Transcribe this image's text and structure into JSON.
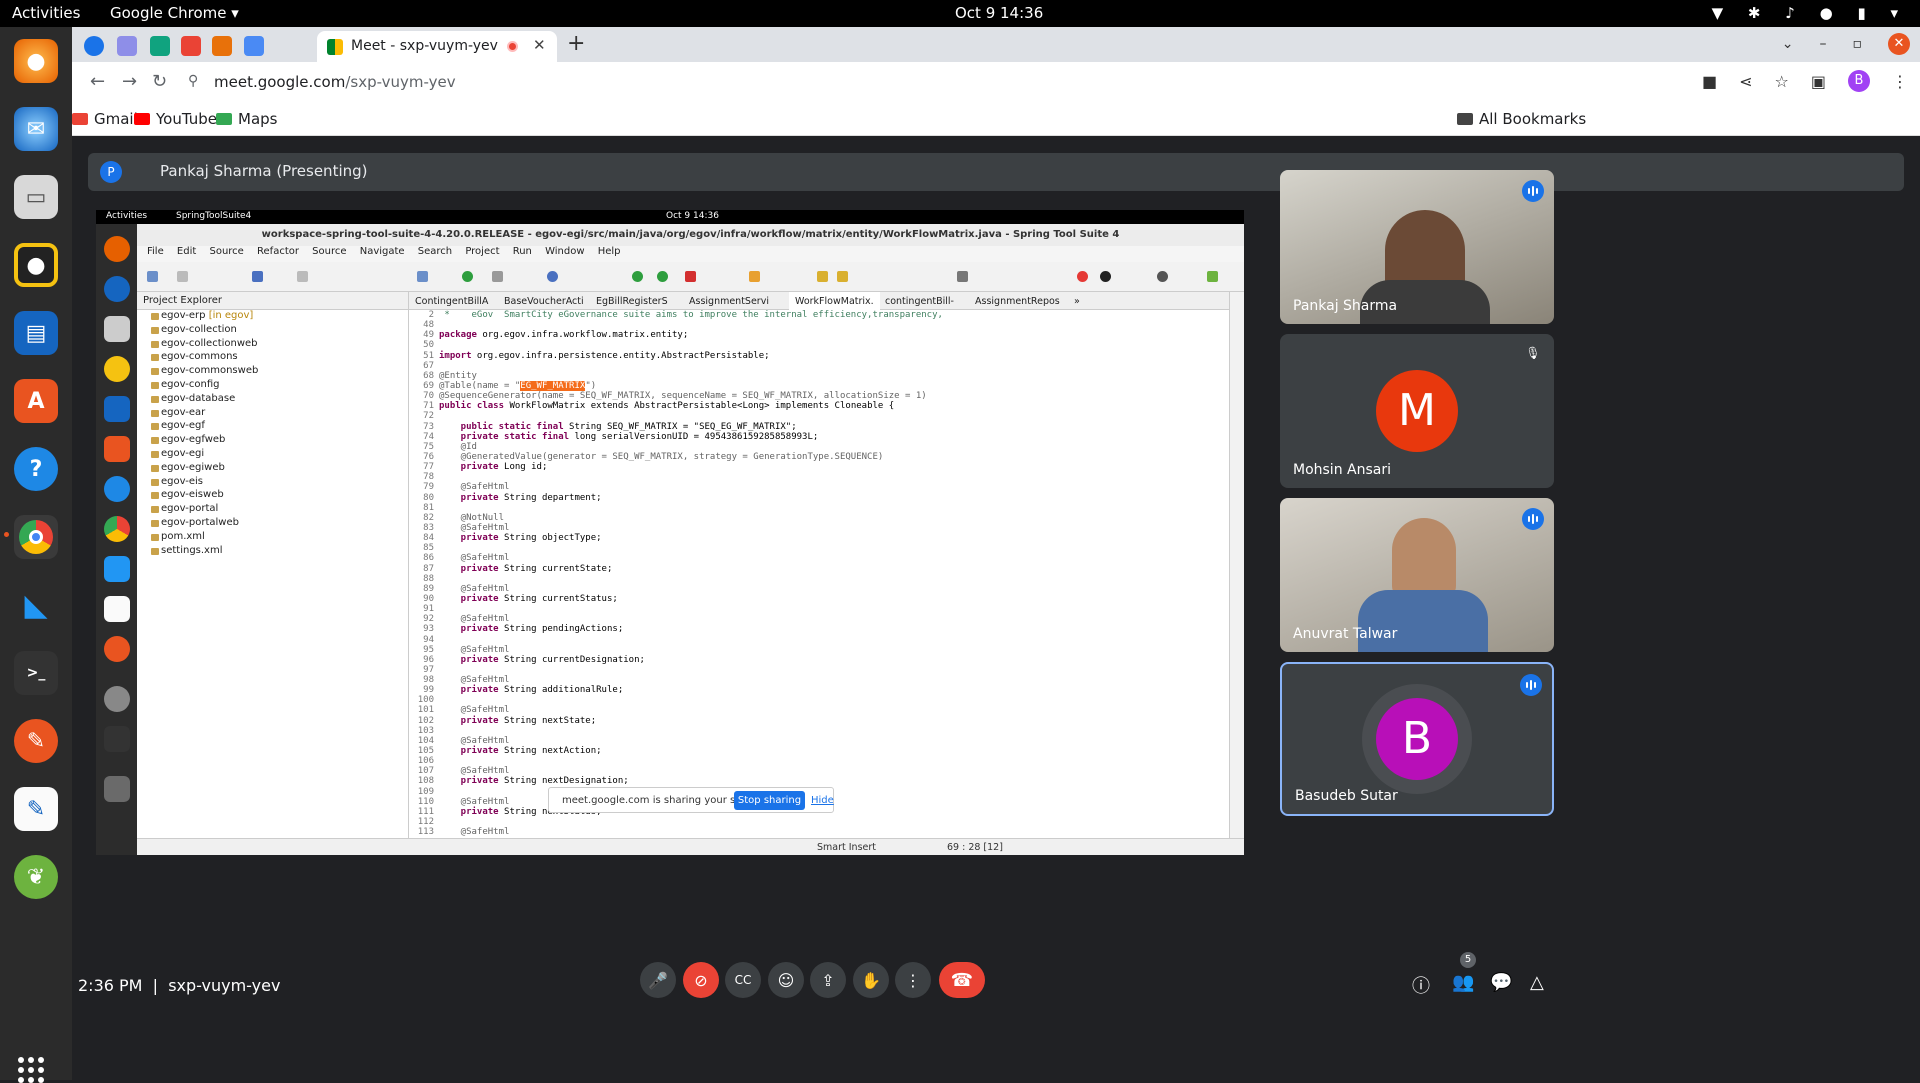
{
  "os": {
    "activities": "Activities",
    "app_name": "Google Chrome ▾",
    "clock": "Oct 9  14:36"
  },
  "browser": {
    "tab_title": "Meet - sxp-vuym-yev",
    "url_host": "meet.google.com",
    "url_path": "/sxp-vuym-yev",
    "bookmarks": [
      "Gmail",
      "YouTube",
      "Maps"
    ],
    "all_bookmarks": "All Bookmarks",
    "avatar_letter": "B"
  },
  "meet": {
    "presenter_initial": "P",
    "presenter_label": "Pankaj Sharma (Presenting)",
    "meeting_time": "2:36 PM",
    "meeting_code": "sxp-vuym-yev",
    "participant_count": "5",
    "participants": [
      {
        "name": "Pankaj Sharma"
      },
      {
        "name": "Mohsin Ansari",
        "initial": "M",
        "color": "#e8380d"
      },
      {
        "name": "Anuvrat Talwar"
      },
      {
        "name": "Basudeb Sutar",
        "initial": "B",
        "color": "#b80fb8"
      }
    ],
    "sharing": {
      "text": "meet.google.com is sharing your screen.",
      "stop": "Stop sharing",
      "hide": "Hide"
    }
  },
  "shared_screen": {
    "activities": "Activities",
    "app_name": "SpringToolSuite4",
    "clock": "Oct 9  14:36",
    "window_title": "workspace-spring-tool-suite-4-4.20.0.RELEASE - egov-egi/src/main/java/org/egov/infra/workflow/matrix/entity/WorkFlowMatrix.java - Spring Tool Suite 4",
    "menu": [
      "File",
      "Edit",
      "Source",
      "Refactor",
      "Source",
      "Navigate",
      "Search",
      "Project",
      "Run",
      "Window",
      "Help"
    ],
    "project_explorer_title": "Project Explorer",
    "root_project": "egov-erp",
    "root_tag": "[in egov]",
    "tree": [
      "egov-collection",
      "egov-collectionweb",
      "egov-commons",
      "egov-commonsweb",
      "egov-config",
      "egov-database",
      "egov-ear",
      "egov-egf",
      "egov-egfweb",
      "egov-egi",
      "egov-egiweb",
      "egov-eis",
      "egov-eisweb",
      "egov-portal",
      "egov-portalweb",
      "pom.xml",
      "settings.xml"
    ],
    "editor_tabs": [
      "ContingentBillA",
      "BaseVoucherActi",
      "EgBillRegisterS",
      "AssignmentServi",
      "WorkFlowMatrix.",
      "contingentBill-",
      "AssignmentRepos",
      "»"
    ],
    "status_mode": "Smart Insert",
    "status_pos": "69 : 28 [12]"
  },
  "code_lines": [
    {
      "n": "2",
      "t": " *    eGov  SmartCity eGovernance suite aims to improve the internal efficiency,transparency,",
      "c": "cm"
    },
    {
      "n": "48",
      "t": ""
    },
    {
      "n": "49",
      "k": "package",
      "t": " org.egov.infra.workflow.matrix.entity;"
    },
    {
      "n": "50",
      "t": ""
    },
    {
      "n": "51",
      "k": "import",
      "t": " org.egov.infra.persistence.entity.AbstractPersistable;"
    },
    {
      "n": "67",
      "t": ""
    },
    {
      "n": "68",
      "t": "@Entity",
      "c": "an"
    },
    {
      "n": "69",
      "t": "@Table(name = \"EG_WF_MATRIX\")",
      "c": "an"
    },
    {
      "n": "70",
      "t": "@SequenceGenerator(name = SEQ_WF_MATRIX, sequenceName = SEQ_WF_MATRIX, allocationSize = 1)",
      "c": "an"
    },
    {
      "n": "71",
      "k": "public class",
      "t": " WorkFlowMatrix extends AbstractPersistable<Long> implements Cloneable {"
    },
    {
      "n": "72",
      "t": ""
    },
    {
      "n": "73",
      "k": "    public static final",
      "t": " String SEQ_WF_MATRIX = \"SEQ_EG_WF_MATRIX\";"
    },
    {
      "n": "74",
      "k": "    private static final",
      "t": " long serialVersionUID = 4954386159285858993L;"
    },
    {
      "n": "75",
      "t": "    @Id",
      "c": "an"
    },
    {
      "n": "76",
      "t": "    @GeneratedValue(generator = SEQ_WF_MATRIX, strategy = GenerationType.SEQUENCE)",
      "c": "an"
    },
    {
      "n": "77",
      "k": "    private",
      "t": " Long id;"
    },
    {
      "n": "78",
      "t": ""
    },
    {
      "n": "79",
      "t": "    @SafeHtml",
      "c": "an"
    },
    {
      "n": "80",
      "k": "    private",
      "t": " String department;"
    },
    {
      "n": "81",
      "t": ""
    },
    {
      "n": "82",
      "t": "    @NotNull",
      "c": "an"
    },
    {
      "n": "83",
      "t": "    @SafeHtml",
      "c": "an"
    },
    {
      "n": "84",
      "k": "    private",
      "t": " String objectType;"
    },
    {
      "n": "85",
      "t": ""
    },
    {
      "n": "86",
      "t": "    @SafeHtml",
      "c": "an"
    },
    {
      "n": "87",
      "k": "    private",
      "t": " String currentState;"
    },
    {
      "n": "88",
      "t": ""
    },
    {
      "n": "89",
      "t": "    @SafeHtml",
      "c": "an"
    },
    {
      "n": "90",
      "k": "    private",
      "t": " String currentStatus;"
    },
    {
      "n": "91",
      "t": ""
    },
    {
      "n": "92",
      "t": "    @SafeHtml",
      "c": "an"
    },
    {
      "n": "93",
      "k": "    private",
      "t": " String pendingActions;"
    },
    {
      "n": "94",
      "t": ""
    },
    {
      "n": "95",
      "t": "    @SafeHtml",
      "c": "an"
    },
    {
      "n": "96",
      "k": "    private",
      "t": " String currentDesignation;"
    },
    {
      "n": "97",
      "t": ""
    },
    {
      "n": "98",
      "t": "    @SafeHtml",
      "c": "an"
    },
    {
      "n": "99",
      "k": "    private",
      "t": " String additionalRule;"
    },
    {
      "n": "100",
      "t": ""
    },
    {
      "n": "101",
      "t": "    @SafeHtml",
      "c": "an"
    },
    {
      "n": "102",
      "k": "    private",
      "t": " String nextState;"
    },
    {
      "n": "103",
      "t": ""
    },
    {
      "n": "104",
      "t": "    @SafeHtml",
      "c": "an"
    },
    {
      "n": "105",
      "k": "    private",
      "t": " String nextAction;"
    },
    {
      "n": "106",
      "t": ""
    },
    {
      "n": "107",
      "t": "    @SafeHtml",
      "c": "an"
    },
    {
      "n": "108",
      "k": "    private",
      "t": " String nextDesignation;"
    },
    {
      "n": "109",
      "t": ""
    },
    {
      "n": "110",
      "t": "    @SafeHtml",
      "c": "an"
    },
    {
      "n": "111",
      "k": "    private",
      "t": " String nextStatus;"
    },
    {
      "n": "112",
      "t": ""
    },
    {
      "n": "113",
      "t": "    @SafeHtml",
      "c": "an"
    }
  ]
}
